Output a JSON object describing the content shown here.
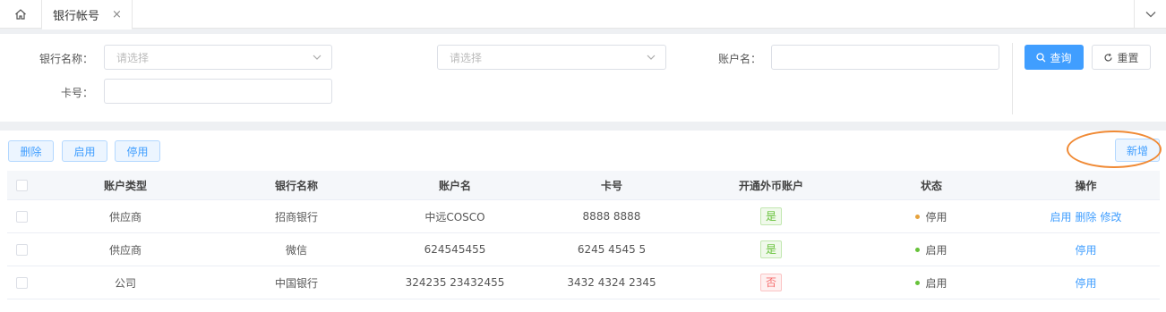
{
  "tabs": {
    "active_label": "银行帐号",
    "close_glyph": "×"
  },
  "search": {
    "bank_name_label": "银行名称：",
    "bank_name_placeholder": "请选择",
    "second_select_placeholder": "请选择",
    "account_name_label": "账户名：",
    "account_name_value": "",
    "card_no_label": "卡号：",
    "card_no_value": "",
    "query_label": "查询",
    "reset_label": "重置"
  },
  "toolbar": {
    "delete_label": "删除",
    "enable_label": "启用",
    "disable_label": "停用",
    "add_label": "新增"
  },
  "table": {
    "columns": [
      "账户类型",
      "银行名称",
      "账户名",
      "卡号",
      "开通外币账户",
      "状态",
      "操作"
    ],
    "rows": [
      {
        "type": "供应商",
        "bank": "招商银行",
        "account_name": "中远COSCO",
        "card": "8888 8888",
        "foreign": "是",
        "status": "停用",
        "actions": [
          "启用",
          "删除",
          "修改"
        ]
      },
      {
        "type": "供应商",
        "bank": "微信",
        "account_name": "624545455",
        "card": "6245 4545 5",
        "foreign": "是",
        "status": "启用",
        "actions": [
          "停用"
        ]
      },
      {
        "type": "公司",
        "bank": "中国银行",
        "account_name": "324235 23432455",
        "card": "3432 4324 2345",
        "foreign": "否",
        "status": "启用",
        "actions": [
          "停用"
        ]
      }
    ]
  },
  "colors": {
    "primary": "#409eff",
    "status_disabled": "#e6a23c",
    "status_enabled": "#67c23a",
    "highlight": "#f08a35"
  }
}
